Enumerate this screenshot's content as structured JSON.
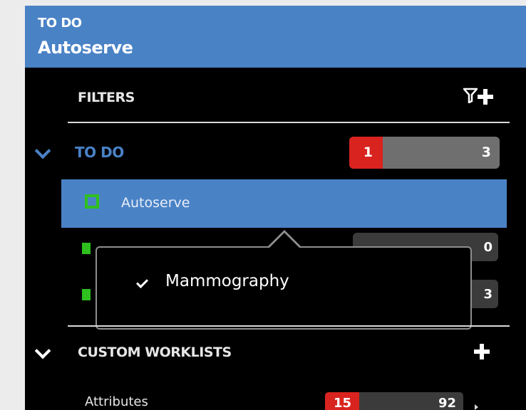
{
  "header": {
    "section": "TO DO",
    "title": "Autoserve"
  },
  "filters": {
    "label": "FILTERS",
    "icons": [
      "filter-icon",
      "plus-icon"
    ]
  },
  "todo": {
    "label": "TO DO",
    "unread": "1",
    "total": "3"
  },
  "selected_item": {
    "label": "Autoserve",
    "icon": "square-icon"
  },
  "hidden_rows": [
    {
      "icon": "lock-icon",
      "count": "0"
    },
    {
      "icon": "calendar-icon",
      "count": "3"
    }
  ],
  "popup": {
    "checked_item": "Mammography"
  },
  "custom_worklists": {
    "label": "CUSTOM WORKLISTS"
  },
  "attributes": {
    "label": "Attributes",
    "unread": "15",
    "total": "92"
  },
  "colors": {
    "header_blue": "#4a82c6",
    "accent_green": "#2ec01e",
    "badge_red": "#d9231f",
    "panel_bg": "#000000"
  }
}
